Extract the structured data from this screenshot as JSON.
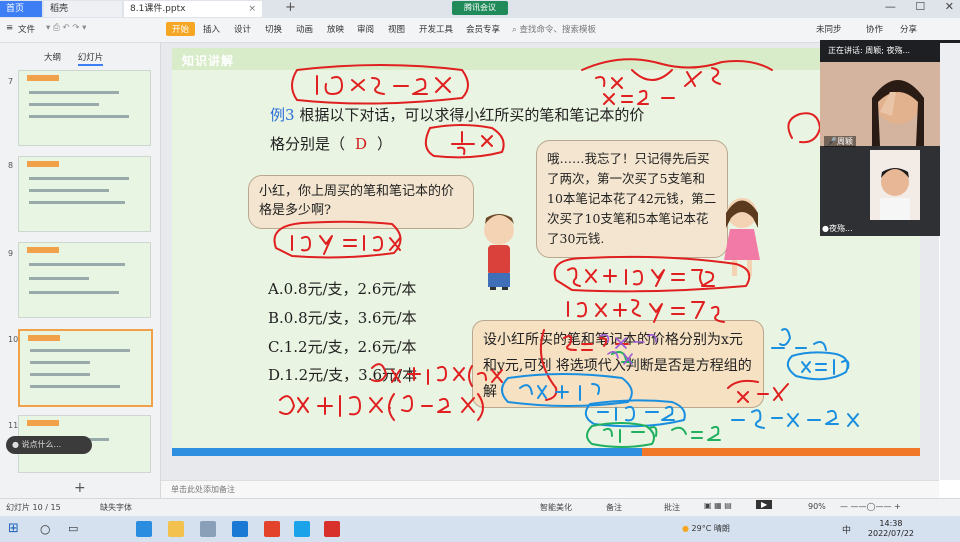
{
  "tabs": {
    "home": "首页",
    "daoke": "稻壳",
    "file": "8.1课件.pptx",
    "plus": "+",
    "meeting": "腾讯会议"
  },
  "window": {
    "minimize": "—",
    "maximize": "☐",
    "close": "✕"
  },
  "ribbon": {
    "file_menu": "文件",
    "items": [
      "开始",
      "插入",
      "设计",
      "切换",
      "动画",
      "放映",
      "审阅",
      "视图",
      "开发工具",
      "会员专享"
    ],
    "search_placeholder": "查找命令、搜索模板",
    "right": [
      "未同步",
      "协作",
      "分享"
    ]
  },
  "left_panel": {
    "tab_outline": "大纲",
    "tab_slides": "幻灯片",
    "slide_numbers": [
      "7",
      "8",
      "9",
      "10",
      "11"
    ],
    "add_slide": "+",
    "voice_hint": "说点什么..."
  },
  "slide": {
    "logo_left": "知识讲解",
    "logo_right": "淘",
    "example_label": "例3",
    "question_line1": "根据以下对话，可以求得小红所买的笔和笔记本的价",
    "question_line2": "格分别是（",
    "answer": "D",
    "question_close": "）",
    "bubble_boy": "小红，你上周买的笔和笔记本的价格是多少啊?",
    "bubble_girl": "哦……我忘了！只记得先后买了两次，第一次买了5支笔和10本笔记本花了42元钱，第二次买了10支笔和5本笔记本花了30元钱.",
    "options": [
      "A.0.8元/支，2.6元/本",
      "B.0.8元/支，3.6元/本",
      "C.1.2元/支，2.6元/本",
      "D.1.2元/支，3.6元/本"
    ],
    "hint": "设小红所买的笔和笔记本的价格分别为x元和y元,可列      将选项代入判断是否是方程组的解"
  },
  "webcam": {
    "top_label": "正在讲话: 周颖; 夜殇...",
    "name1": "周颖",
    "name2": "夜殇..."
  },
  "notes_placeholder": "单击此处添加备注",
  "status": {
    "slide_count": "幻灯片 10 / 15",
    "font_missing": "缺失字体",
    "smart_beautify": "智能美化",
    "notes": "备注",
    "comments": "批注",
    "zoom": "90%"
  },
  "taskbar": {
    "weather": "29°C 晴朗",
    "ime": "中",
    "time": "14:38",
    "date": "2022/07/22"
  }
}
